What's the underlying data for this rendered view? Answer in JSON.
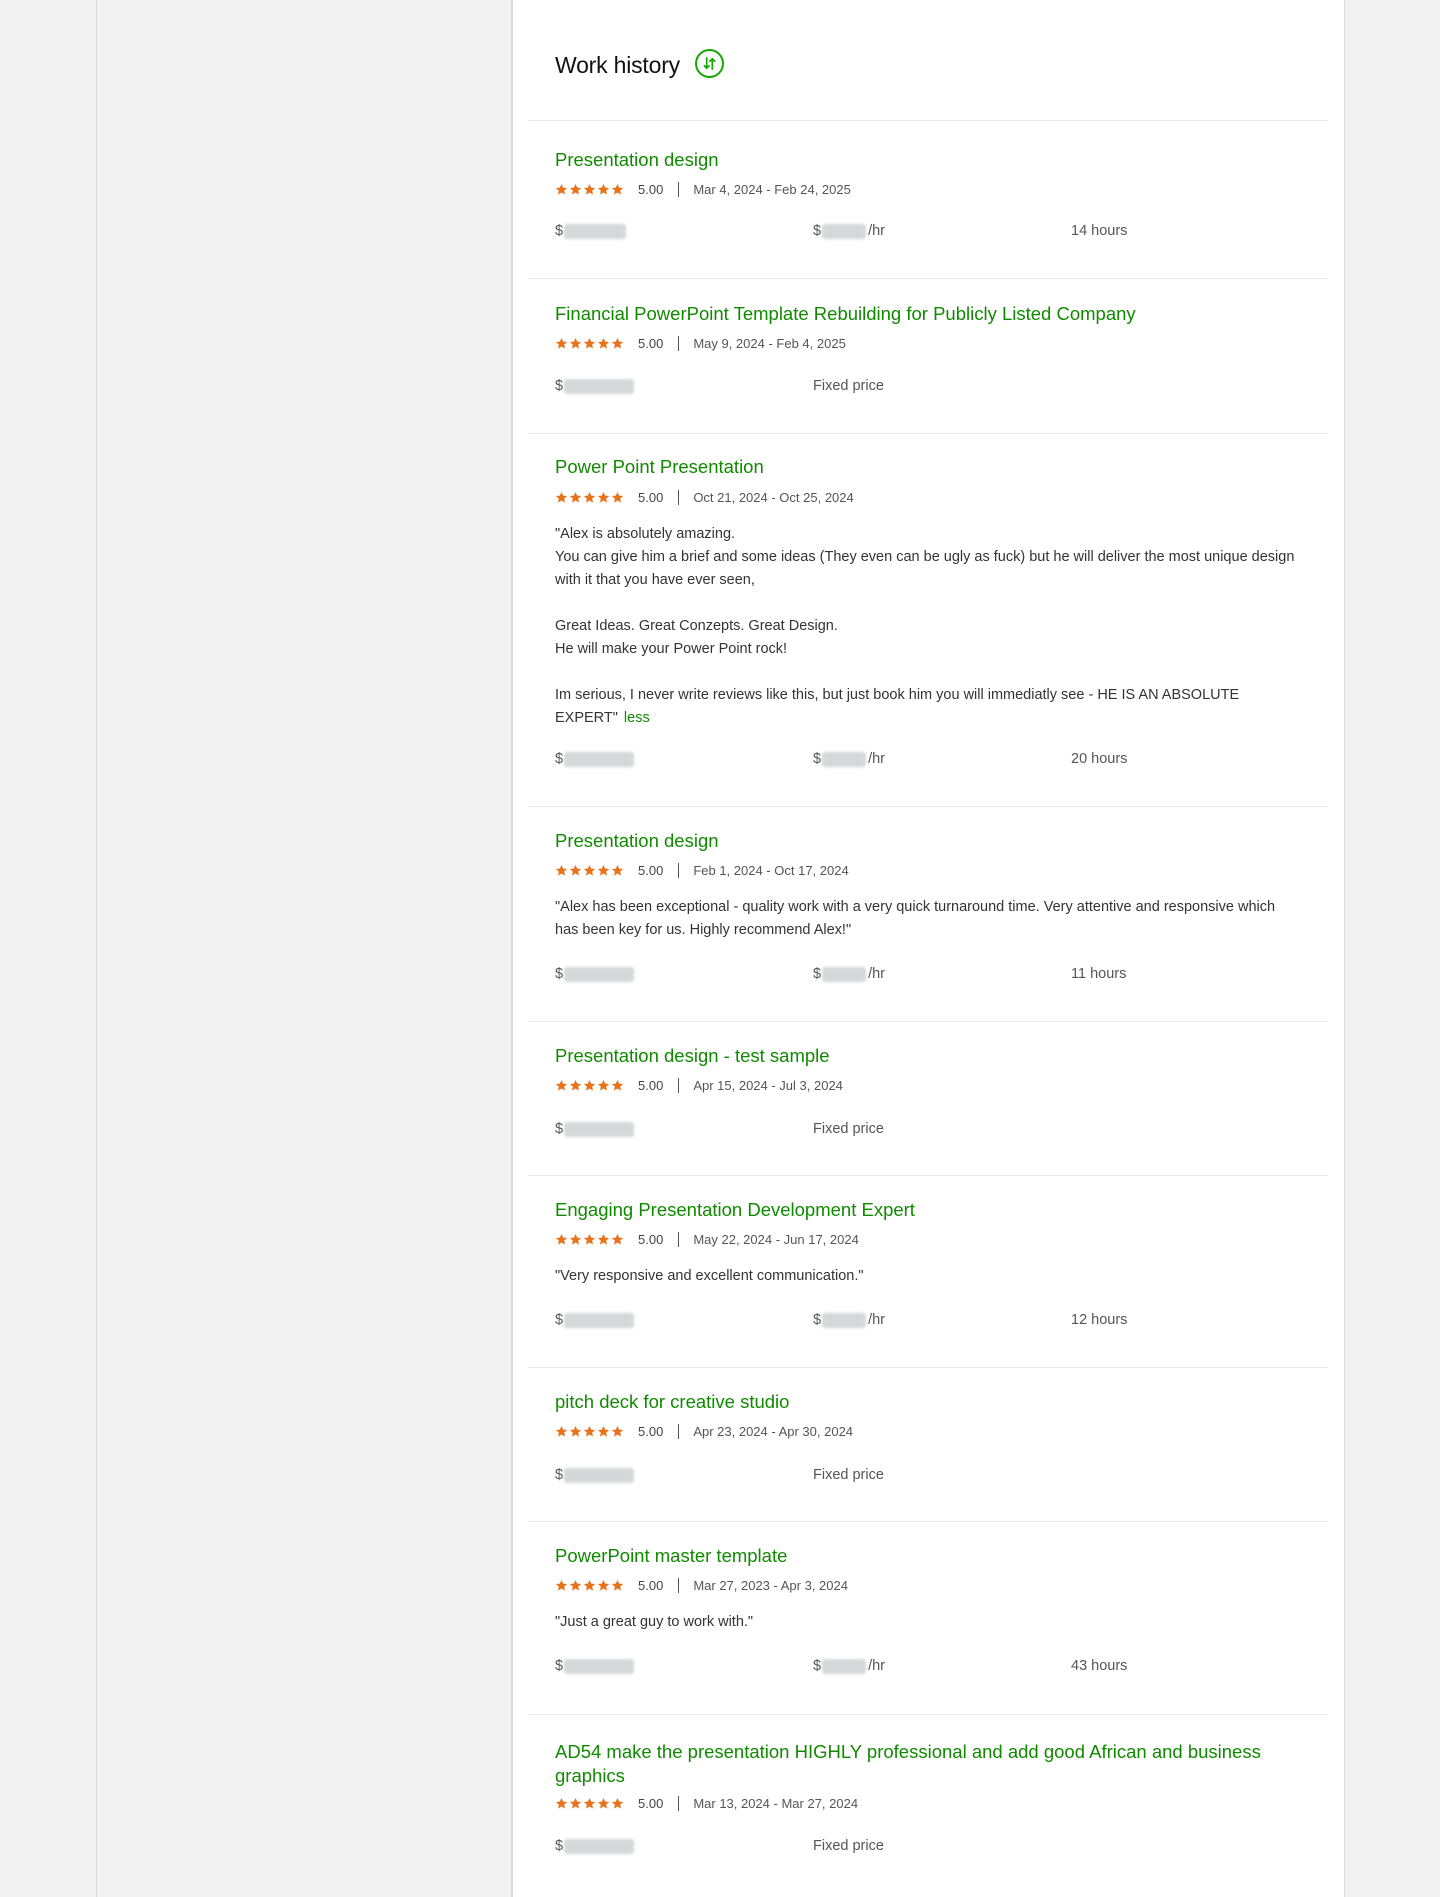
{
  "section": {
    "title": "Work history",
    "sort_icon": "sort-arrows-icon"
  },
  "colors": {
    "accent": "#108a00",
    "star": "#e8731d"
  },
  "jobs": [
    {
      "title": "Presentation design",
      "rating": "5.00",
      "dates": "Mar 4, 2024 - Feb 24, 2025",
      "feedback": "",
      "earned_prefix": "$",
      "rate_prefix": "$",
      "rate_suffix": "/hr",
      "duration": "14 hours"
    },
    {
      "title": "Financial PowerPoint Template Rebuilding for Publicly Listed Company",
      "rating": "5.00",
      "dates": "May 9, 2024 - Feb 4, 2025",
      "feedback": "",
      "earned_prefix": "$",
      "contract_type": "Fixed price"
    },
    {
      "title": "Power Point Presentation",
      "rating": "5.00",
      "dates": "Oct 21, 2024 - Oct 25, 2024",
      "feedback": "\"Alex is absolutely amazing.\nYou can give him a brief and some ideas (They even can be ugly as fuck) but he will deliver the most unique design with it that you have ever seen,\n\nGreat Ideas. Great Conzepts. Great Design.\nHe will make your Power Point rock!\n\nIm serious, I never write reviews like this, but just book him you will immediatly see - HE IS AN ABSOLUTE EXPERT\"",
      "less_label": "less",
      "earned_prefix": "$",
      "rate_prefix": "$",
      "rate_suffix": "/hr",
      "duration": "20 hours"
    },
    {
      "title": "Presentation design",
      "rating": "5.00",
      "dates": "Feb 1, 2024 - Oct 17, 2024",
      "feedback": "\"Alex has been exceptional - quality work with a very quick turnaround time. Very attentive and responsive which has been key for us. Highly recommend Alex!\"",
      "earned_prefix": "$",
      "rate_prefix": "$",
      "rate_suffix": "/hr",
      "duration": "11 hours"
    },
    {
      "title": "Presentation design - test sample",
      "rating": "5.00",
      "dates": "Apr 15, 2024 - Jul 3, 2024",
      "feedback": "",
      "earned_prefix": "$",
      "contract_type": "Fixed price"
    },
    {
      "title": "Engaging Presentation Development Expert",
      "rating": "5.00",
      "dates": "May 22, 2024 - Jun 17, 2024",
      "feedback": "\"Very responsive and excellent communication.\"",
      "earned_prefix": "$",
      "rate_prefix": "$",
      "rate_suffix": "/hr",
      "duration": "12 hours"
    },
    {
      "title": "pitch deck for creative studio",
      "rating": "5.00",
      "dates": "Apr 23, 2024 - Apr 30, 2024",
      "feedback": "",
      "earned_prefix": "$",
      "contract_type": "Fixed price"
    },
    {
      "title": "PowerPoint master template",
      "rating": "5.00",
      "dates": "Mar 27, 2023 - Apr 3, 2024",
      "feedback": "\"Just a great guy to work with.\"",
      "earned_prefix": "$",
      "rate_prefix": "$",
      "rate_suffix": "/hr",
      "duration": "43 hours"
    },
    {
      "title": "AD54 make the presentation HIGHLY professional and add good African and business graphics",
      "rating": "5.00",
      "dates": "Mar 13, 2024 - Mar 27, 2024",
      "feedback": "",
      "earned_prefix": "$",
      "contract_type": "Fixed price"
    }
  ]
}
